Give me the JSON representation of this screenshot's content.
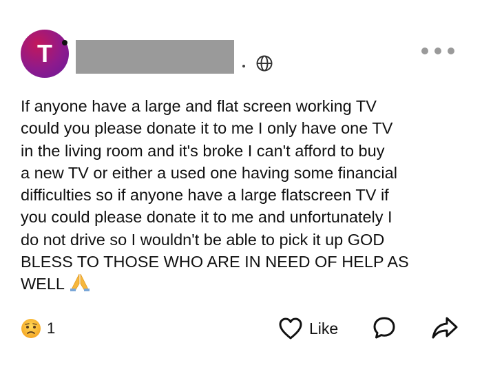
{
  "post": {
    "author_initial": "T",
    "body": "If anyone have a large and flat screen working TV\ncould you please donate it to me I only have one TV\nin the living room and it's broke I can't afford to buy\na new TV or either a used one having some financial\ndifficulties so if anyone have a large flatscreen TV if\nyou could please donate it to me and unfortunately I\ndo not drive so I wouldn't be able to pick it up GOD\nBLESS TO THOSE WHO ARE IN NEED OF HELP AS\nWELL",
    "audience_icon": "globe-icon",
    "menu_icon": "more-options-icon",
    "trailing_emoji": "praying-hands-emoji"
  },
  "footer": {
    "reaction_icon": "sad-face-emoji",
    "reaction_count": "1",
    "like_label": "Like",
    "like_icon": "heart-outline-icon",
    "comment_icon": "speech-bubble-icon",
    "share_icon": "share-arrow-icon"
  },
  "colors": {
    "avatar": "#8e1a8c",
    "redaction": "#9a9a9a",
    "text": "#111111"
  }
}
